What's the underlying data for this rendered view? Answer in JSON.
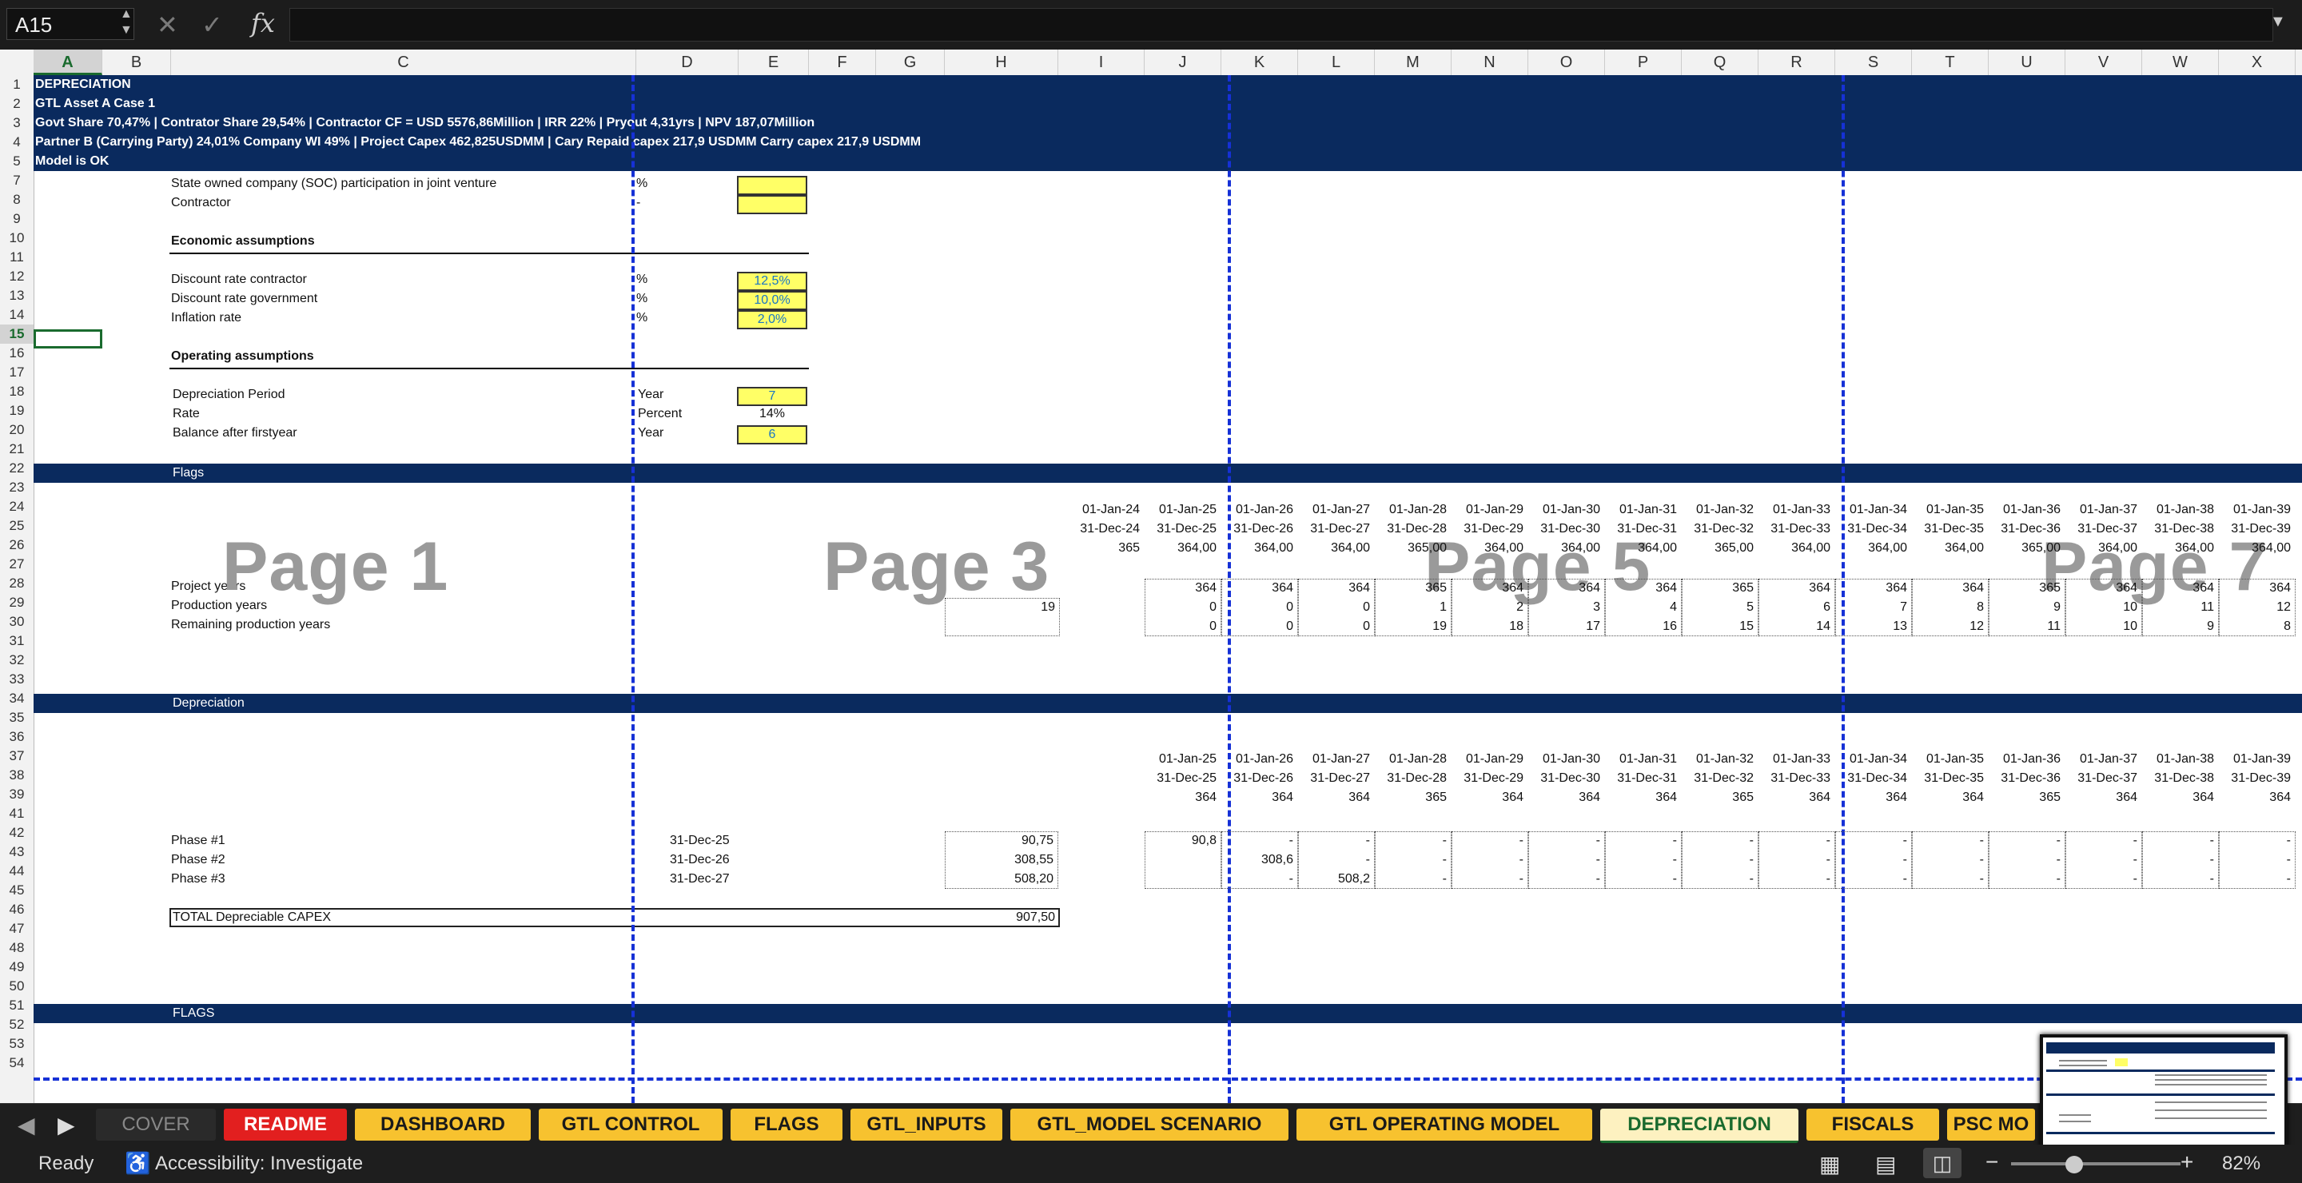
{
  "formula_bar": {
    "name_box": "A15",
    "formula": "",
    "fx_label": "fx"
  },
  "columns": [
    "A",
    "B",
    "C",
    "D",
    "E",
    "F",
    "G",
    "H",
    "I",
    "J",
    "K",
    "L",
    "M",
    "N",
    "O",
    "P",
    "Q",
    "R",
    "S",
    "T",
    "U",
    "V",
    "W",
    "X"
  ],
  "selected_column": "A",
  "selected_row": "15",
  "rows": [
    "1",
    "2",
    "3",
    "4",
    "5",
    "7",
    "8",
    "9",
    "10",
    "11",
    "12",
    "13",
    "14",
    "15",
    "16",
    "17",
    "18",
    "19",
    "20",
    "21",
    "22",
    "23",
    "24",
    "25",
    "26",
    "27",
    "28",
    "29",
    "30",
    "31",
    "32",
    "33",
    "34",
    "35",
    "36",
    "37",
    "38",
    "39",
    "41",
    "42",
    "43",
    "44",
    "45",
    "46",
    "47",
    "48",
    "49",
    "50",
    "51",
    "52",
    "53",
    "54"
  ],
  "header": {
    "title": "DEPRECIATION",
    "subtitle": "GTL Asset A  Case 1",
    "line3": "Govt Share 70,47% | Contrator Share 29,54% |  Contractor CF = USD 5576,86Million | IRR 22% | Pryout 4,31yrs | NPV 187,07Million",
    "line4": "Partner B (Carrying Party) 24,01% Company WI 49% |  Project Capex  462,825USDMM  |  Cary Repaid capex 217,9  USDMM Carry capex 217,9  USDMM",
    "line5": "Model is OK"
  },
  "assumptions": {
    "soc_label": "State owned company (SOC) participation in joint venture",
    "soc_unit": "%",
    "contractor_label": "Contractor",
    "contractor_unit": "-",
    "econ_title": "Economic assumptions",
    "disc_contractor_label": "Discount rate contractor",
    "disc_contractor_unit": "%",
    "disc_contractor_value": "12,5%",
    "disc_gov_label": "Discount rate government",
    "disc_gov_unit": "%",
    "disc_gov_value": "10,0%",
    "inflation_label": "Inflation rate",
    "inflation_unit": "%",
    "inflation_value": "2,0%",
    "op_title": "Operating assumptions",
    "dep_period_label": "Depreciation Period",
    "dep_period_unit": "Year",
    "dep_period_value": "7",
    "rate_label": "Rate",
    "rate_unit": "Percent",
    "rate_value": "14%",
    "balance_label": "Balance after firstyear",
    "balance_unit": "Year",
    "balance_value": "6"
  },
  "flags_section": {
    "title": "Flags",
    "start_dates": [
      "01-Jan-24",
      "01-Jan-25",
      "01-Jan-26",
      "01-Jan-27",
      "01-Jan-28",
      "01-Jan-29",
      "01-Jan-30",
      "01-Jan-31",
      "01-Jan-32",
      "01-Jan-33",
      "01-Jan-34",
      "01-Jan-35",
      "01-Jan-36",
      "01-Jan-37",
      "01-Jan-38",
      "01-Jan-39"
    ],
    "end_dates": [
      "31-Dec-24",
      "31-Dec-25",
      "31-Dec-26",
      "31-Dec-27",
      "31-Dec-28",
      "31-Dec-29",
      "31-Dec-30",
      "31-Dec-31",
      "31-Dec-32",
      "31-Dec-33",
      "31-Dec-34",
      "31-Dec-35",
      "31-Dec-36",
      "31-Dec-37",
      "31-Dec-38",
      "31-Dec-39"
    ],
    "days": [
      "365",
      "364,00",
      "364,00",
      "364,00",
      "365,00",
      "364,00",
      "364,00",
      "364,00",
      "365,00",
      "364,00",
      "364,00",
      "364,00",
      "365,00",
      "364,00",
      "364,00",
      "364,00"
    ],
    "project_years_label": "Project years",
    "project_years": [
      "364",
      "364",
      "364",
      "365",
      "364",
      "364",
      "364",
      "365",
      "364",
      "364",
      "364",
      "365",
      "364",
      "364",
      "364"
    ],
    "production_years_label": "Production years",
    "production_years_total": "19",
    "production_years": [
      "0",
      "0",
      "0",
      "1",
      "2",
      "3",
      "4",
      "5",
      "6",
      "7",
      "8",
      "9",
      "10",
      "11",
      "12"
    ],
    "remaining_label": "Remaining production years",
    "remaining": [
      "0",
      "0",
      "0",
      "19",
      "18",
      "17",
      "16",
      "15",
      "14",
      "13",
      "12",
      "11",
      "10",
      "9",
      "8"
    ]
  },
  "depreciation_section": {
    "title": "Depreciation",
    "start_dates": [
      "01-Jan-25",
      "01-Jan-26",
      "01-Jan-27",
      "01-Jan-28",
      "01-Jan-29",
      "01-Jan-30",
      "01-Jan-31",
      "01-Jan-32",
      "01-Jan-33",
      "01-Jan-34",
      "01-Jan-35",
      "01-Jan-36",
      "01-Jan-37",
      "01-Jan-38",
      "01-Jan-39"
    ],
    "end_dates": [
      "31-Dec-25",
      "31-Dec-26",
      "31-Dec-27",
      "31-Dec-28",
      "31-Dec-29",
      "31-Dec-30",
      "31-Dec-31",
      "31-Dec-32",
      "31-Dec-33",
      "31-Dec-34",
      "31-Dec-35",
      "31-Dec-36",
      "31-Dec-37",
      "31-Dec-38",
      "31-Dec-39"
    ],
    "days": [
      "364",
      "364",
      "364",
      "365",
      "364",
      "364",
      "364",
      "365",
      "364",
      "364",
      "364",
      "365",
      "364",
      "364",
      "364"
    ],
    "phases": [
      {
        "label": "Phase #1",
        "date": "31-Dec-25",
        "total": "90,75",
        "values": [
          "90,8",
          "-",
          "-",
          "-",
          "-",
          "-",
          "-",
          "-",
          "-",
          "-",
          "-",
          "-",
          "-",
          "-",
          "-"
        ]
      },
      {
        "label": "Phase #2",
        "date": "31-Dec-26",
        "total": "308,55",
        "values": [
          "",
          "308,6",
          "-",
          "-",
          "-",
          "-",
          "-",
          "-",
          "-",
          "-",
          "-",
          "-",
          "-",
          "-",
          "-"
        ]
      },
      {
        "label": "Phase #3",
        "date": "31-Dec-27",
        "total": "508,20",
        "values": [
          "",
          "-",
          "508,2",
          "-",
          "-",
          "-",
          "-",
          "-",
          "-",
          "-",
          "-",
          "-",
          "-",
          "-",
          "-"
        ]
      }
    ],
    "total_label": "TOTAL Depreciable CAPEX",
    "total_value": "907,50"
  },
  "flags2_title": "FLAGS",
  "page_labels": [
    "Page 1",
    "Page 3",
    "Page 5",
    "Page 7"
  ],
  "tabs": [
    {
      "label": "COVER",
      "style": "gray"
    },
    {
      "label": "README",
      "style": "red"
    },
    {
      "label": "DASHBOARD",
      "style": "yellow"
    },
    {
      "label": "GTL CONTROL",
      "style": "yellow"
    },
    {
      "label": "FLAGS",
      "style": "yellow"
    },
    {
      "label": "GTL_INPUTS",
      "style": "yellow"
    },
    {
      "label": "GTL_MODEL SCENARIO",
      "style": "yellow"
    },
    {
      "label": "GTL OPERATING MODEL",
      "style": "yellow"
    },
    {
      "label": "DEPRECIATION",
      "style": "active"
    },
    {
      "label": "FISCALS",
      "style": "yellow"
    },
    {
      "label": "PSC MO",
      "style": "yellow"
    }
  ],
  "status_bar": {
    "ready": "Ready",
    "accessibility": "Accessibility: Investigate",
    "zoom": "82%"
  }
}
